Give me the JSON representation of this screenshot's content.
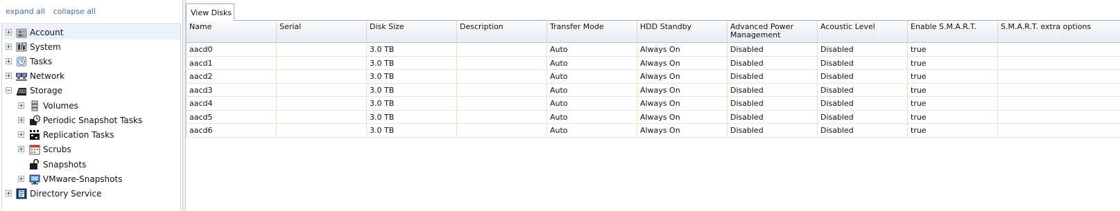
{
  "tree_links": {
    "expand_all": "expand all",
    "collapse_all": "collapse all"
  },
  "tree": {
    "items": [
      {
        "label": "Account",
        "icon": "users-icon",
        "expander": "plus",
        "level": 0,
        "selected": true
      },
      {
        "label": "System",
        "icon": "system-icon",
        "expander": "plus",
        "level": 0
      },
      {
        "label": "Tasks",
        "icon": "tasks-icon",
        "expander": "plus",
        "level": 0
      },
      {
        "label": "Network",
        "icon": "network-icon",
        "expander": "plus",
        "level": 0
      },
      {
        "label": "Storage",
        "icon": "storage-icon",
        "expander": "minus",
        "level": 0
      },
      {
        "label": "Volumes",
        "icon": "volumes-icon",
        "expander": "plus",
        "level": 1
      },
      {
        "label": "Periodic Snapshot Tasks",
        "icon": "periodic-snapshot-icon",
        "expander": "plus",
        "level": 1
      },
      {
        "label": "Replication Tasks",
        "icon": "replication-icon",
        "expander": "plus",
        "level": 1
      },
      {
        "label": "Scrubs",
        "icon": "calendar-icon",
        "expander": "plus",
        "level": 1
      },
      {
        "label": "Snapshots",
        "icon": "snapshot-icon",
        "expander": "none",
        "level": 1
      },
      {
        "label": "VMware-Snapshots",
        "icon": "vmware-icon",
        "expander": "plus",
        "level": 1
      },
      {
        "label": "Directory Service",
        "icon": "directory-service-icon",
        "expander": "plus",
        "level": 0
      }
    ]
  },
  "tabs": [
    {
      "label": "View Disks",
      "active": true
    }
  ],
  "grid": {
    "columns": [
      "Name",
      "Serial",
      "Disk Size",
      "Description",
      "Transfer Mode",
      "HDD Standby",
      "Advanced Power Management",
      "Acoustic Level",
      "Enable S.M.A.R.T.",
      "S.M.A.R.T. extra options"
    ],
    "rows": [
      [
        "aacd0",
        "",
        "3.0 TB",
        "",
        "Auto",
        "Always On",
        "Disabled",
        "Disabled",
        "true",
        ""
      ],
      [
        "aacd1",
        "",
        "3.0 TB",
        "",
        "Auto",
        "Always On",
        "Disabled",
        "Disabled",
        "true",
        ""
      ],
      [
        "aacd2",
        "",
        "3.0 TB",
        "",
        "Auto",
        "Always On",
        "Disabled",
        "Disabled",
        "true",
        ""
      ],
      [
        "aacd3",
        "",
        "3.0 TB",
        "",
        "Auto",
        "Always On",
        "Disabled",
        "Disabled",
        "true",
        ""
      ],
      [
        "aacd4",
        "",
        "3.0 TB",
        "",
        "Auto",
        "Always On",
        "Disabled",
        "Disabled",
        "true",
        ""
      ],
      [
        "aacd5",
        "",
        "3.0 TB",
        "",
        "Auto",
        "Always On",
        "Disabled",
        "Disabled",
        "true",
        ""
      ],
      [
        "aacd6",
        "",
        "3.0 TB",
        "",
        "Auto",
        "Always On",
        "Disabled",
        "Disabled",
        "true",
        ""
      ]
    ]
  }
}
